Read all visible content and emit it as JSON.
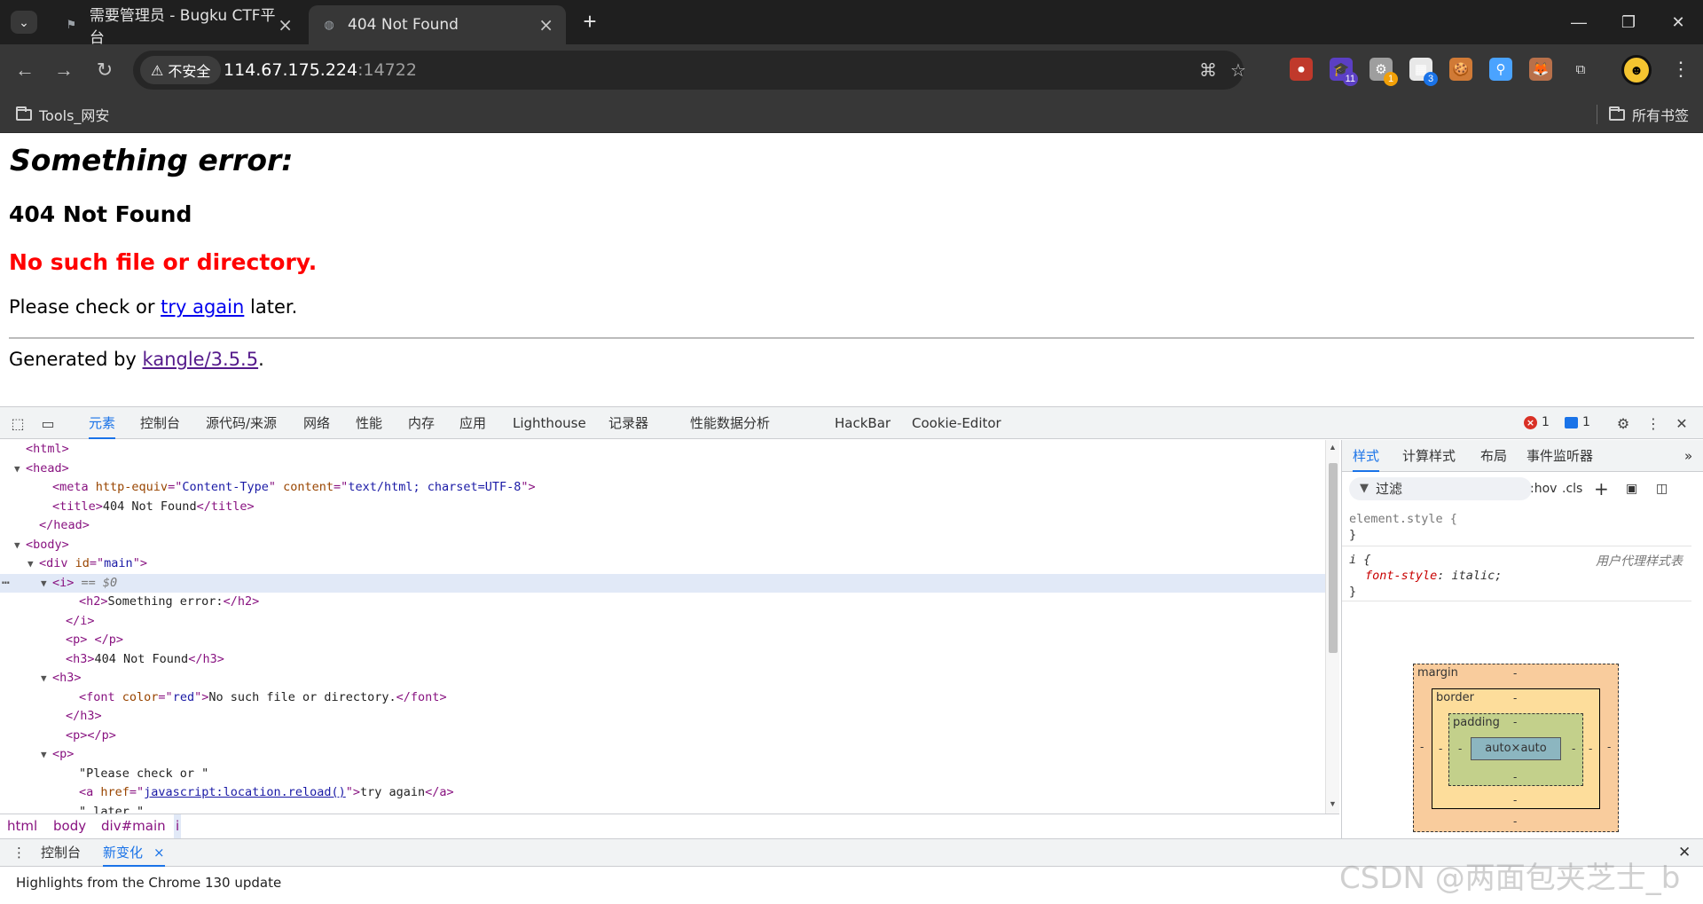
{
  "browser": {
    "tabs": [
      {
        "title": "需要管理员 - Bugku CTF平台",
        "active": false
      },
      {
        "title": "404 Not Found",
        "active": true
      }
    ],
    "security_label": "不安全",
    "url_host": "114.67.175.224",
    "url_port": ":14722",
    "extensions": [
      {
        "icon": "record-extension-icon",
        "color": "#c0392b",
        "badge": ""
      },
      {
        "icon": "hat-extension-icon",
        "color": "#5b3fc4",
        "badge": "11",
        "badge_color": "#5b3fc4"
      },
      {
        "icon": "gear-extension-icon",
        "color": "#9e9e9e",
        "badge": "1",
        "badge_color": "#f2a007"
      },
      {
        "icon": "wappalyzer-extension-icon",
        "color": "#e8e8e8",
        "badge": "3",
        "badge_color": "#1a73e8"
      },
      {
        "icon": "cookie-extension-icon",
        "color": "#d07a36",
        "badge": ""
      },
      {
        "icon": "pin-extension-icon",
        "color": "#4aa3ff",
        "badge": ""
      },
      {
        "icon": "fox-extension-icon",
        "color": "#b8704a",
        "badge": ""
      }
    ],
    "bookmarks": {
      "left_folder": "Tools_网安",
      "right_folder": "所有书签"
    }
  },
  "page": {
    "heading_italic": "Something error:",
    "heading_404": "404 Not Found",
    "error_red": "No such file or directory.",
    "check_prefix": "Please check or ",
    "check_link": "try again",
    "check_suffix": " later.",
    "generated_prefix": "Generated by ",
    "generated_link": "kangle/3.5.5",
    "generated_suffix": "."
  },
  "devtools": {
    "tabs": [
      "元素",
      "控制台",
      "源代码/来源",
      "网络",
      "性能",
      "内存",
      "应用",
      "Lighthouse",
      "记录器",
      "性能数据分析",
      "HackBar",
      "Cookie-Editor"
    ],
    "active_tab": "元素",
    "error_count": "1",
    "message_count": "1",
    "dom_lines": [
      {
        "indent": 0,
        "tri": "",
        "parts": [
          [
            "tn",
            "<html>"
          ]
        ]
      },
      {
        "indent": 0,
        "tri": "▼",
        "parts": [
          [
            "tn",
            "<head>"
          ]
        ]
      },
      {
        "indent": 2,
        "tri": "",
        "parts": [
          [
            "tn",
            "<meta "
          ],
          [
            "an",
            "http-equiv"
          ],
          [
            "tn",
            "=\""
          ],
          [
            "av",
            "Content-Type"
          ],
          [
            "tn",
            "\" "
          ],
          [
            "an",
            "content"
          ],
          [
            "tn",
            "=\""
          ],
          [
            "av",
            "text/html; charset=UTF-8"
          ],
          [
            "tn",
            "\">"
          ]
        ]
      },
      {
        "indent": 2,
        "tri": "",
        "parts": [
          [
            "tn",
            "<title>"
          ],
          [
            "tx",
            "404 Not Found"
          ],
          [
            "tn",
            "</title>"
          ]
        ]
      },
      {
        "indent": 1,
        "tri": "",
        "parts": [
          [
            "tn",
            "</head>"
          ]
        ]
      },
      {
        "indent": 0,
        "tri": "▼",
        "parts": [
          [
            "tn",
            "<body>"
          ]
        ]
      },
      {
        "indent": 1,
        "tri": "▼",
        "parts": [
          [
            "tn",
            "<div "
          ],
          [
            "an",
            "id"
          ],
          [
            "tn",
            "=\""
          ],
          [
            "av",
            "main"
          ],
          [
            "tn",
            "\">"
          ]
        ]
      },
      {
        "indent": 2,
        "tri": "▼",
        "selected": true,
        "parts": [
          [
            "tn",
            "<i>"
          ],
          [
            "cm",
            " == $0"
          ]
        ]
      },
      {
        "indent": 4,
        "tri": "",
        "parts": [
          [
            "tn",
            "<h2>"
          ],
          [
            "tx",
            "Something error:"
          ],
          [
            "tn",
            "</h2>"
          ]
        ]
      },
      {
        "indent": 3,
        "tri": "",
        "parts": [
          [
            "tn",
            "</i>"
          ]
        ]
      },
      {
        "indent": 3,
        "tri": "",
        "parts": [
          [
            "tn",
            "<p> </p>"
          ]
        ]
      },
      {
        "indent": 3,
        "tri": "",
        "parts": [
          [
            "tn",
            "<h3>"
          ],
          [
            "tx",
            "404 Not Found"
          ],
          [
            "tn",
            "</h3>"
          ]
        ]
      },
      {
        "indent": 2,
        "tri": "▼",
        "parts": [
          [
            "tn",
            "<h3>"
          ]
        ]
      },
      {
        "indent": 4,
        "tri": "",
        "parts": [
          [
            "tn",
            "<font "
          ],
          [
            "an",
            "color"
          ],
          [
            "tn",
            "=\""
          ],
          [
            "av",
            "red"
          ],
          [
            "tn",
            "\">"
          ],
          [
            "tx",
            "No such file or directory."
          ],
          [
            "tn",
            "</font>"
          ]
        ]
      },
      {
        "indent": 3,
        "tri": "",
        "parts": [
          [
            "tn",
            "</h3>"
          ]
        ]
      },
      {
        "indent": 3,
        "tri": "",
        "parts": [
          [
            "tn",
            "<p></p>"
          ]
        ]
      },
      {
        "indent": 2,
        "tri": "▼",
        "parts": [
          [
            "tn",
            "<p>"
          ]
        ]
      },
      {
        "indent": 4,
        "tri": "",
        "parts": [
          [
            "tx",
            "\"Please check or \""
          ]
        ]
      },
      {
        "indent": 4,
        "tri": "",
        "parts": [
          [
            "tn",
            "<a "
          ],
          [
            "an",
            "href"
          ],
          [
            "tn",
            "=\""
          ],
          [
            "avlink",
            "javascript:location.reload()"
          ],
          [
            "tn",
            "\">"
          ],
          [
            "tx",
            "try again"
          ],
          [
            "tn",
            "</a>"
          ]
        ]
      },
      {
        "indent": 4,
        "tri": "",
        "parts": [
          [
            "tx",
            "\" later.\""
          ]
        ]
      }
    ],
    "breadcrumbs": [
      "html",
      "body",
      "div#main",
      "i"
    ],
    "styles_tabs": [
      "样式",
      "计算样式",
      "布局",
      "事件监听器"
    ],
    "filter_placeholder": "过滤",
    "hov_label": ":hov",
    "cls_label": ".cls",
    "rule_element_style_open": "element.style {",
    "rule_close": "}",
    "rule_i_selector": "i {",
    "rule_i_source": "用户代理样式表",
    "rule_i_prop": "font-style",
    "rule_i_value": ": italic;",
    "box_model": {
      "margin_label": "margin",
      "border_label": "border",
      "padding_label": "padding",
      "content": "auto×auto",
      "dash": "-"
    },
    "drawer_tabs": [
      "控制台",
      "新变化"
    ],
    "drawer_active": "新变化",
    "drawer_text": "Highlights from the Chrome 130 update"
  },
  "watermark": "CSDN @两面包夹芝士_b"
}
